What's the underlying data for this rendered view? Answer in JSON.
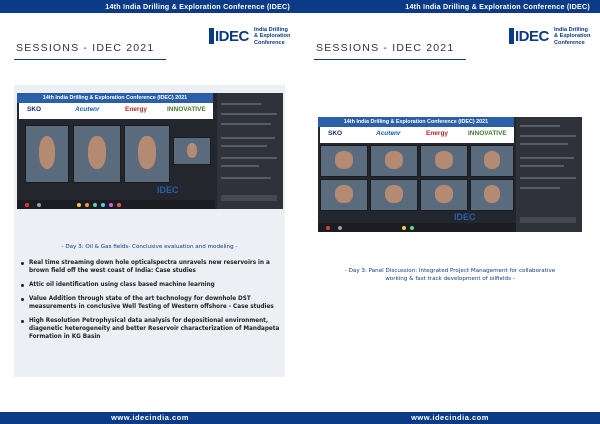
{
  "conference_header": "14th India Drilling & Exploration Conference (IDEC)",
  "website": "www.idecindia.com",
  "logo": {
    "mark": "IDEC",
    "tagline_lines": [
      "India Drilling",
      "& Exploration Conference"
    ]
  },
  "session_heading": "SESSIONS - IDEC 2021",
  "screenshot": {
    "banner": "14th India Drilling & Exploration Conference (IDEC) 2021",
    "sponsors": [
      "SKO",
      "Acutenr",
      "Energy",
      "INNOVATIVE"
    ]
  },
  "pages": [
    {
      "caption": "- Day 3: Oil & Gas fields- Conclusive evaluation and modeling -",
      "bullets": [
        "Real time streaming down hole opticalspectra unravels new reservoirs in a brown field off the west coast of India: Case studies",
        "Attic oil identification using class based machine learning",
        "Value Addition through state of the art technology for downhole DST measurements in conclusive Well Testing of Western offshore - Case studies",
        "High Resolution Petrophysical data analysis for depositional environment, diagenetic heterogeneity and better Reservoir characterization of Mandapeta Formation in KG Basin"
      ]
    },
    {
      "caption_lines": [
        "- Day 3: Panel Discussion: Integrated Project Management for collaborative",
        "working & fast track development of oilfields -"
      ]
    }
  ]
}
